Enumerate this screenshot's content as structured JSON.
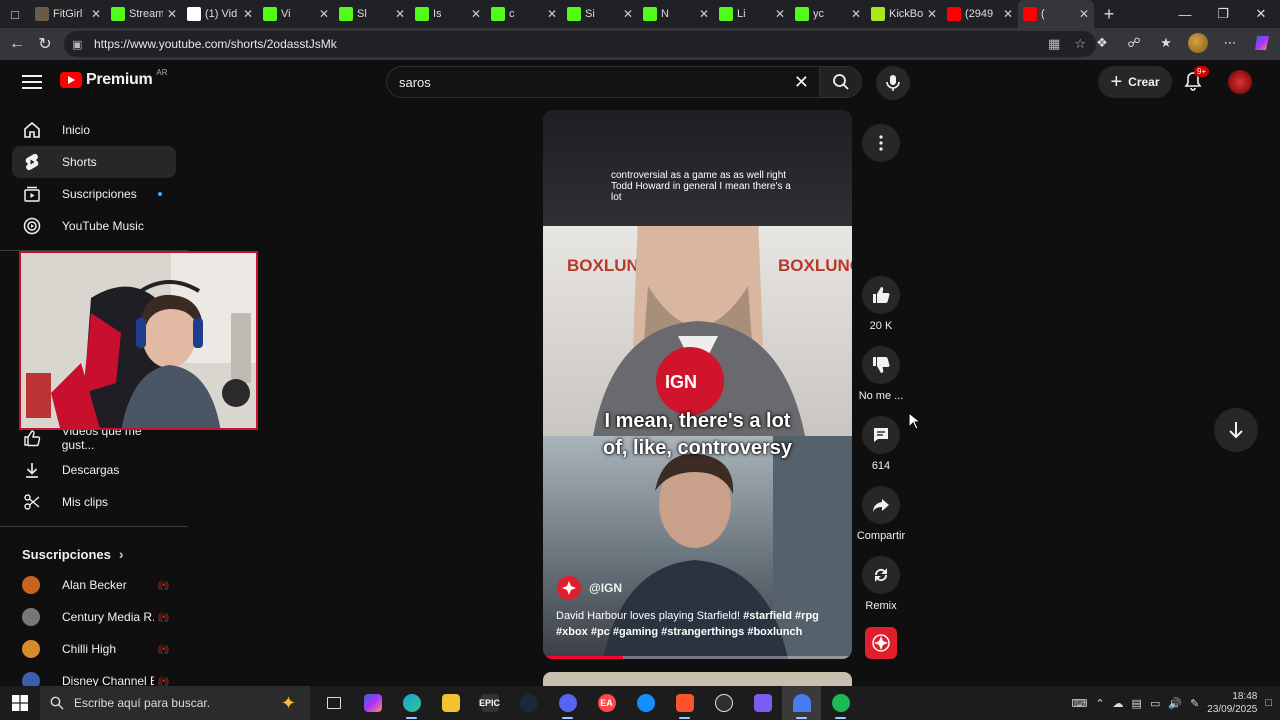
{
  "browser": {
    "tabs": [
      {
        "label": "FitGirl",
        "color": "#6b5a4a"
      },
      {
        "label": "Stream",
        "color": "#53fc18"
      },
      {
        "label": "(1) Vid",
        "color": "#ffffff"
      },
      {
        "label": "Vi",
        "color": "#53fc18"
      },
      {
        "label": "Sl",
        "color": "#53fc18"
      },
      {
        "label": "Is",
        "color": "#53fc18"
      },
      {
        "label": "c",
        "color": "#53fc18"
      },
      {
        "label": "Si",
        "color": "#53fc18"
      },
      {
        "label": "N",
        "color": "#53fc18"
      },
      {
        "label": "Li",
        "color": "#53fc18"
      },
      {
        "label": "yc",
        "color": "#53fc18"
      },
      {
        "label": "KickBo",
        "color": "#a8e81c"
      },
      {
        "label": "(2949",
        "color": "#ff0000"
      },
      {
        "label": "(",
        "color": "#ff0000"
      }
    ],
    "url": "https://www.youtube.com/shorts/2odasstJsMk"
  },
  "header": {
    "logo_text": "Premium",
    "country_code": "AR",
    "search_value": "saros",
    "create_label": "Crear",
    "notif_badge": "9+"
  },
  "sidebar": {
    "items": [
      {
        "label": "Inicio"
      },
      {
        "label": "Shorts"
      },
      {
        "label": "Suscripciones"
      },
      {
        "label": "YouTube Music"
      },
      {
        "label": "Videos que me gust..."
      },
      {
        "label": "Descargas"
      },
      {
        "label": "Mis clips"
      }
    ],
    "subs_title": "Suscripciones",
    "subscriptions": [
      {
        "label": "Alan Becker",
        "color": "#c9641c"
      },
      {
        "label": "Century Media R...",
        "color": "#777777"
      },
      {
        "label": "Chilli High",
        "color": "#d88a2a"
      },
      {
        "label": "Disney Channel E...",
        "color": "#3a5fb0"
      }
    ]
  },
  "short": {
    "caption_top": "controversial as a game as as well right Todd Howard in general I mean there's a lot",
    "caption_line1": "I mean, there's a lot",
    "caption_line2": "of, like, controversy",
    "channel": "@IGN",
    "description_plain": "David Harbour loves playing Starfield! ",
    "hashtags_line1": "#starfield #rpg",
    "hashtags_line2": "#xbox #pc #gaming #strangerthings #boxlunch",
    "progress": 0.26,
    "background_text": "BOXLUNCH"
  },
  "actions": {
    "like_count": "20 K",
    "dislike_label": "No me ...",
    "comments_count": "614",
    "share_label": "Compartir",
    "remix_label": "Remix"
  },
  "taskbar": {
    "search_placeholder": "Escribe aquí para buscar.",
    "time": "18:48",
    "date": "23/09/2025"
  }
}
